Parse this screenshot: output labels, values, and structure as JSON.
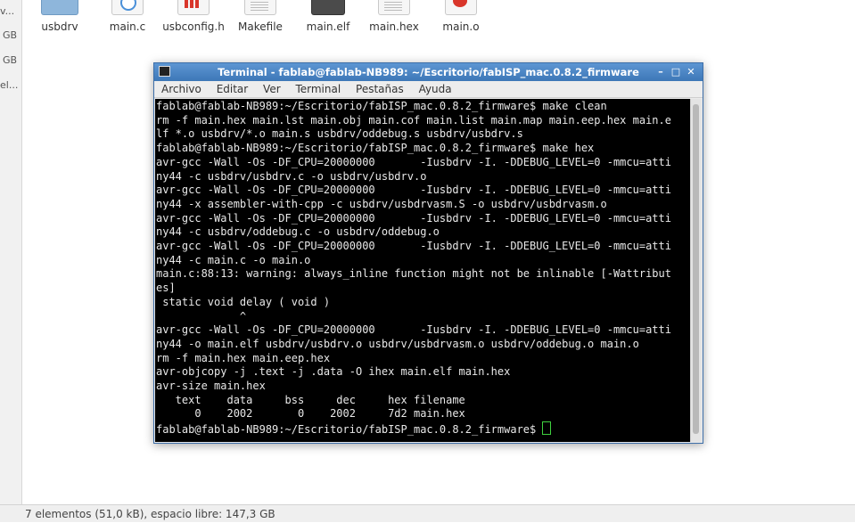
{
  "sidebar": {
    "items": [
      "v...",
      "GB",
      "GB",
      "el..."
    ]
  },
  "files": [
    {
      "name": "usbdrv",
      "icon": "folder-icon"
    },
    {
      "name": "main.c",
      "icon": "c-source-icon"
    },
    {
      "name": "usbconfig.h",
      "icon": "header-file-icon"
    },
    {
      "name": "Makefile",
      "icon": "makefile-icon"
    },
    {
      "name": "main.elf",
      "icon": "executable-icon"
    },
    {
      "name": "main.hex",
      "icon": "text-file-icon"
    },
    {
      "name": "main.o",
      "icon": "object-file-icon"
    }
  ],
  "statusbar": {
    "text": "7 elementos (51,0 kB), espacio libre: 147,3 GB"
  },
  "terminal": {
    "title": "Terminal - fablab@fablab-NB989: ~/Escritorio/fabISP_mac.0.8.2_firmware",
    "controls": {
      "minimize": "–",
      "maximize": "□",
      "close": "✕"
    },
    "menu": [
      "Archivo",
      "Editar",
      "Ver",
      "Terminal",
      "Pestañas",
      "Ayuda"
    ],
    "lines": [
      "fablab@fablab-NB989:~/Escritorio/fabISP_mac.0.8.2_firmware$ make clean",
      "rm -f main.hex main.lst main.obj main.cof main.list main.map main.eep.hex main.e",
      "lf *.o usbdrv/*.o main.s usbdrv/oddebug.s usbdrv/usbdrv.s",
      "fablab@fablab-NB989:~/Escritorio/fabISP_mac.0.8.2_firmware$ make hex",
      "avr-gcc -Wall -Os -DF_CPU=20000000       -Iusbdrv -I. -DDEBUG_LEVEL=0 -mmcu=atti",
      "ny44 -c usbdrv/usbdrv.c -o usbdrv/usbdrv.o",
      "avr-gcc -Wall -Os -DF_CPU=20000000       -Iusbdrv -I. -DDEBUG_LEVEL=0 -mmcu=atti",
      "ny44 -x assembler-with-cpp -c usbdrv/usbdrvasm.S -o usbdrv/usbdrvasm.o",
      "avr-gcc -Wall -Os -DF_CPU=20000000       -Iusbdrv -I. -DDEBUG_LEVEL=0 -mmcu=atti",
      "ny44 -c usbdrv/oddebug.c -o usbdrv/oddebug.o",
      "avr-gcc -Wall -Os -DF_CPU=20000000       -Iusbdrv -I. -DDEBUG_LEVEL=0 -mmcu=atti",
      "ny44 -c main.c -o main.o",
      "main.c:88:13: warning: always_inline function might not be inlinable [-Wattribut",
      "es]",
      " static void delay ( void )",
      "             ^",
      "avr-gcc -Wall -Os -DF_CPU=20000000       -Iusbdrv -I. -DDEBUG_LEVEL=0 -mmcu=atti",
      "ny44 -o main.elf usbdrv/usbdrv.o usbdrv/usbdrvasm.o usbdrv/oddebug.o main.o",
      "rm -f main.hex main.eep.hex",
      "avr-objcopy -j .text -j .data -O ihex main.elf main.hex",
      "avr-size main.hex",
      "   text    data     bss     dec     hex filename",
      "      0    2002       0    2002     7d2 main.hex"
    ],
    "prompt": "fablab@fablab-NB989:~/Escritorio/fabISP_mac.0.8.2_firmware$ "
  }
}
